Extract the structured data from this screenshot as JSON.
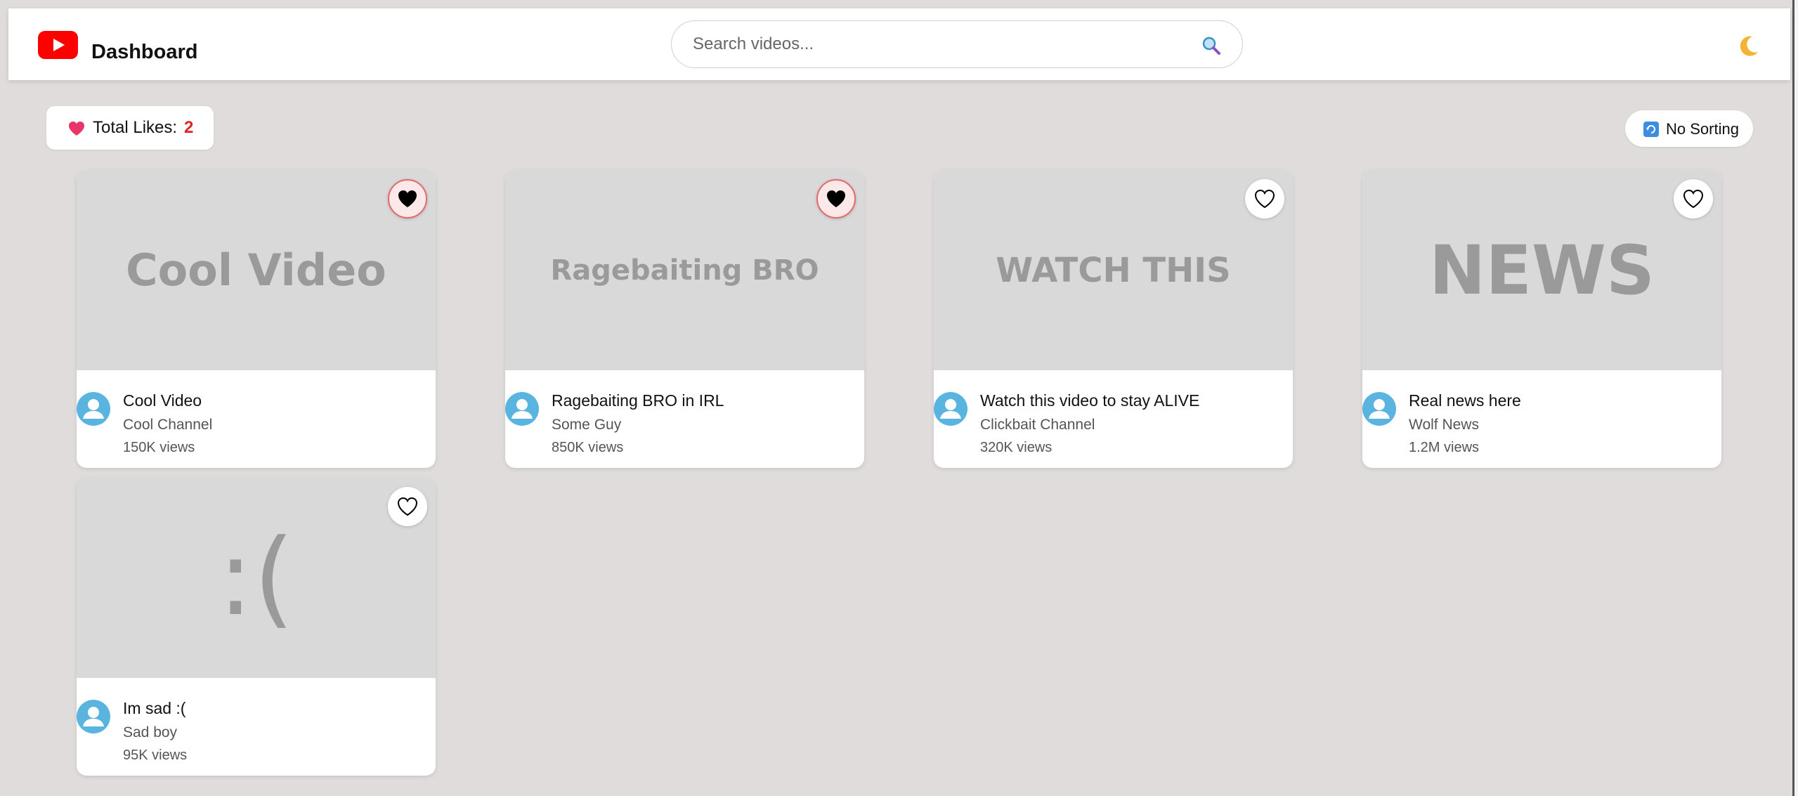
{
  "header": {
    "title": "Dashboard",
    "brand_color": "#ff0000"
  },
  "search": {
    "placeholder": "Search videos...",
    "value": ""
  },
  "toolbar": {
    "likes_label": "Total Likes:",
    "likes_count": "2",
    "sort_label": "No Sorting"
  },
  "icons": {
    "logo": "youtube-play-logo",
    "search": "magnifier-icon",
    "theme": "moon-icon",
    "heart": "heart-icon",
    "sort": "refresh-icon",
    "avatar": "user-avatar-icon"
  },
  "colors": {
    "accent": "#e02424",
    "avatar": "#5ab4e0",
    "background": "#dfdcdb",
    "thumbnail": "#d9d9d9"
  },
  "videos": [
    {
      "thumbnail_text": "Cool Video",
      "title": "Cool Video",
      "channel": "Cool Channel",
      "views": "150K views",
      "liked": true
    },
    {
      "thumbnail_text": "Ragebaiting BRO",
      "title": "Ragebaiting BRO in IRL",
      "channel": "Some Guy",
      "views": "850K views",
      "liked": true
    },
    {
      "thumbnail_text": "WATCH THIS",
      "title": "Watch this video to stay ALIVE",
      "channel": "Clickbait Channel",
      "views": "320K views",
      "liked": false
    },
    {
      "thumbnail_text": "NEWS",
      "title": "Real news here",
      "channel": "Wolf News",
      "views": "1.2M views",
      "liked": false
    },
    {
      "thumbnail_text": ":(",
      "title": "Im sad :(",
      "channel": "Sad boy",
      "views": "95K views",
      "liked": false
    }
  ]
}
